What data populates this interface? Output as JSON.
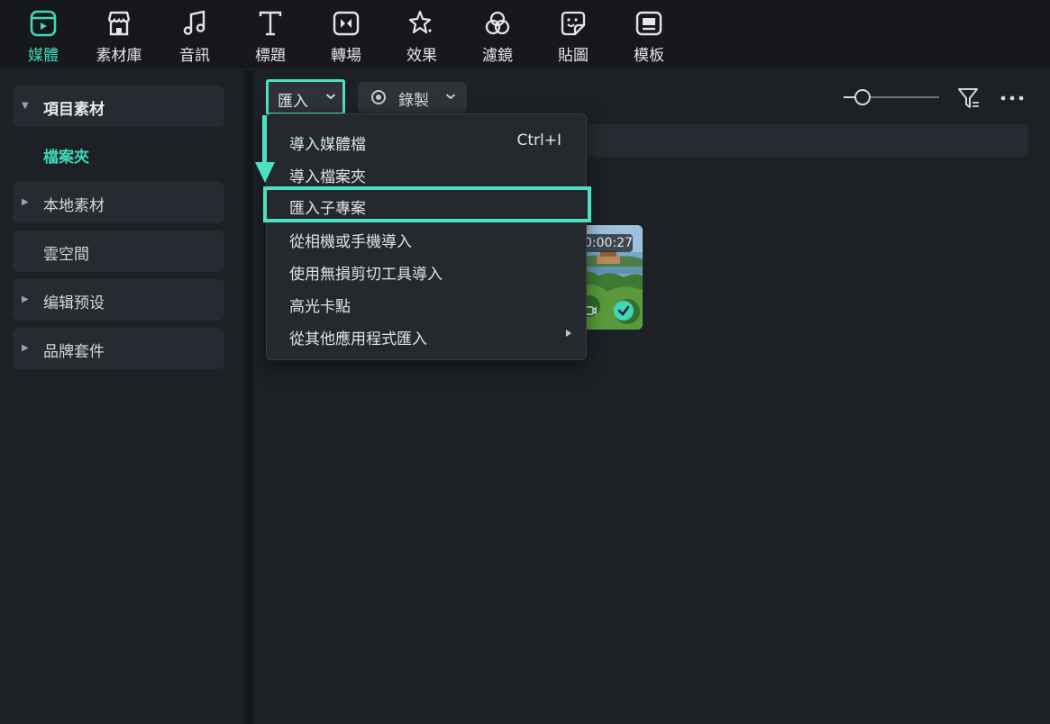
{
  "toolbar": {
    "tabs": [
      {
        "label": "媒體",
        "icon": "media-icon",
        "active": true
      },
      {
        "label": "素材庫",
        "icon": "store-icon",
        "active": false
      },
      {
        "label": "音訊",
        "icon": "music-note-icon",
        "active": false
      },
      {
        "label": "標題",
        "icon": "text-icon",
        "active": false
      },
      {
        "label": "轉場",
        "icon": "transition-icon",
        "active": false
      },
      {
        "label": "效果",
        "icon": "effects-star-icon",
        "active": false
      },
      {
        "label": "濾鏡",
        "icon": "filter-circles-icon",
        "active": false
      },
      {
        "label": "貼圖",
        "icon": "sticker-icon",
        "active": false
      },
      {
        "label": "模板",
        "icon": "template-icon",
        "active": false
      }
    ]
  },
  "sidebar": {
    "items": [
      {
        "label": "項目素材",
        "expanded": true
      },
      {
        "label": "檔案夾"
      },
      {
        "label": "本地素材"
      },
      {
        "label": "雲空間"
      },
      {
        "label": "编辑预设"
      },
      {
        "label": "品牌套件"
      }
    ]
  },
  "actions": {
    "import_label": "匯入",
    "record_label": "錄製"
  },
  "import_menu": {
    "items": [
      {
        "label": "導入媒體檔",
        "shortcut": "Ctrl+I"
      },
      {
        "label": "導入檔案夾"
      },
      {
        "label": "匯入子專案",
        "highlighted": true
      },
      {
        "label": "從相機或手機導入"
      },
      {
        "label": "使用無損剪切工具導入"
      },
      {
        "label": "高光卡點"
      },
      {
        "label": "從其他應用程式匯入",
        "has_submenu": true
      }
    ]
  },
  "media": {
    "clips": [
      {
        "duration": "00:00:27",
        "duration_visible": "0:00:27",
        "selected": true
      }
    ]
  },
  "colors": {
    "accent": "#3ed7b9",
    "annotation": "#4ee0c3",
    "background": "#16181c",
    "panel": "#1d2025"
  }
}
